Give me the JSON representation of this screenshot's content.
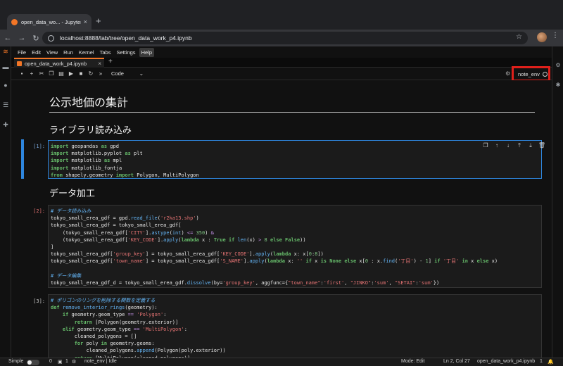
{
  "browser": {
    "tab_title": "open_data_wo... - JupyterLa",
    "url": "localhost:8888/lab/tree/open_data_work_p4.ipynb"
  },
  "menu": [
    "File",
    "Edit",
    "View",
    "Run",
    "Kernel",
    "Tabs",
    "Settings",
    "Help"
  ],
  "active_menu": "Help",
  "doc_tab": {
    "label": "open_data_work_p4.ipynb"
  },
  "toolbar": {
    "cell_type": "Code",
    "kernel_name": "note_env"
  },
  "notebook": {
    "title": "公示地価の集計",
    "section1": "ライブラリ読み込み",
    "section2": "データ加工",
    "prompt1": "[1]:",
    "prompt2": "[2]:",
    "prompt3": "[3]:"
  },
  "statusbar": {
    "mode_label": "Simple",
    "count_a": "0",
    "count_b": "1",
    "kernel_status": "note_env | Idle",
    "edit_mode": "Mode: Edit",
    "cursor": "Ln 2, Col 27",
    "filename": "open_data_work_p4.ipynb",
    "bell_count": "1"
  },
  "colors": {
    "accent": "#2e86de",
    "highlight_box": "#e0201b",
    "jupyter_orange": "#f37626"
  }
}
